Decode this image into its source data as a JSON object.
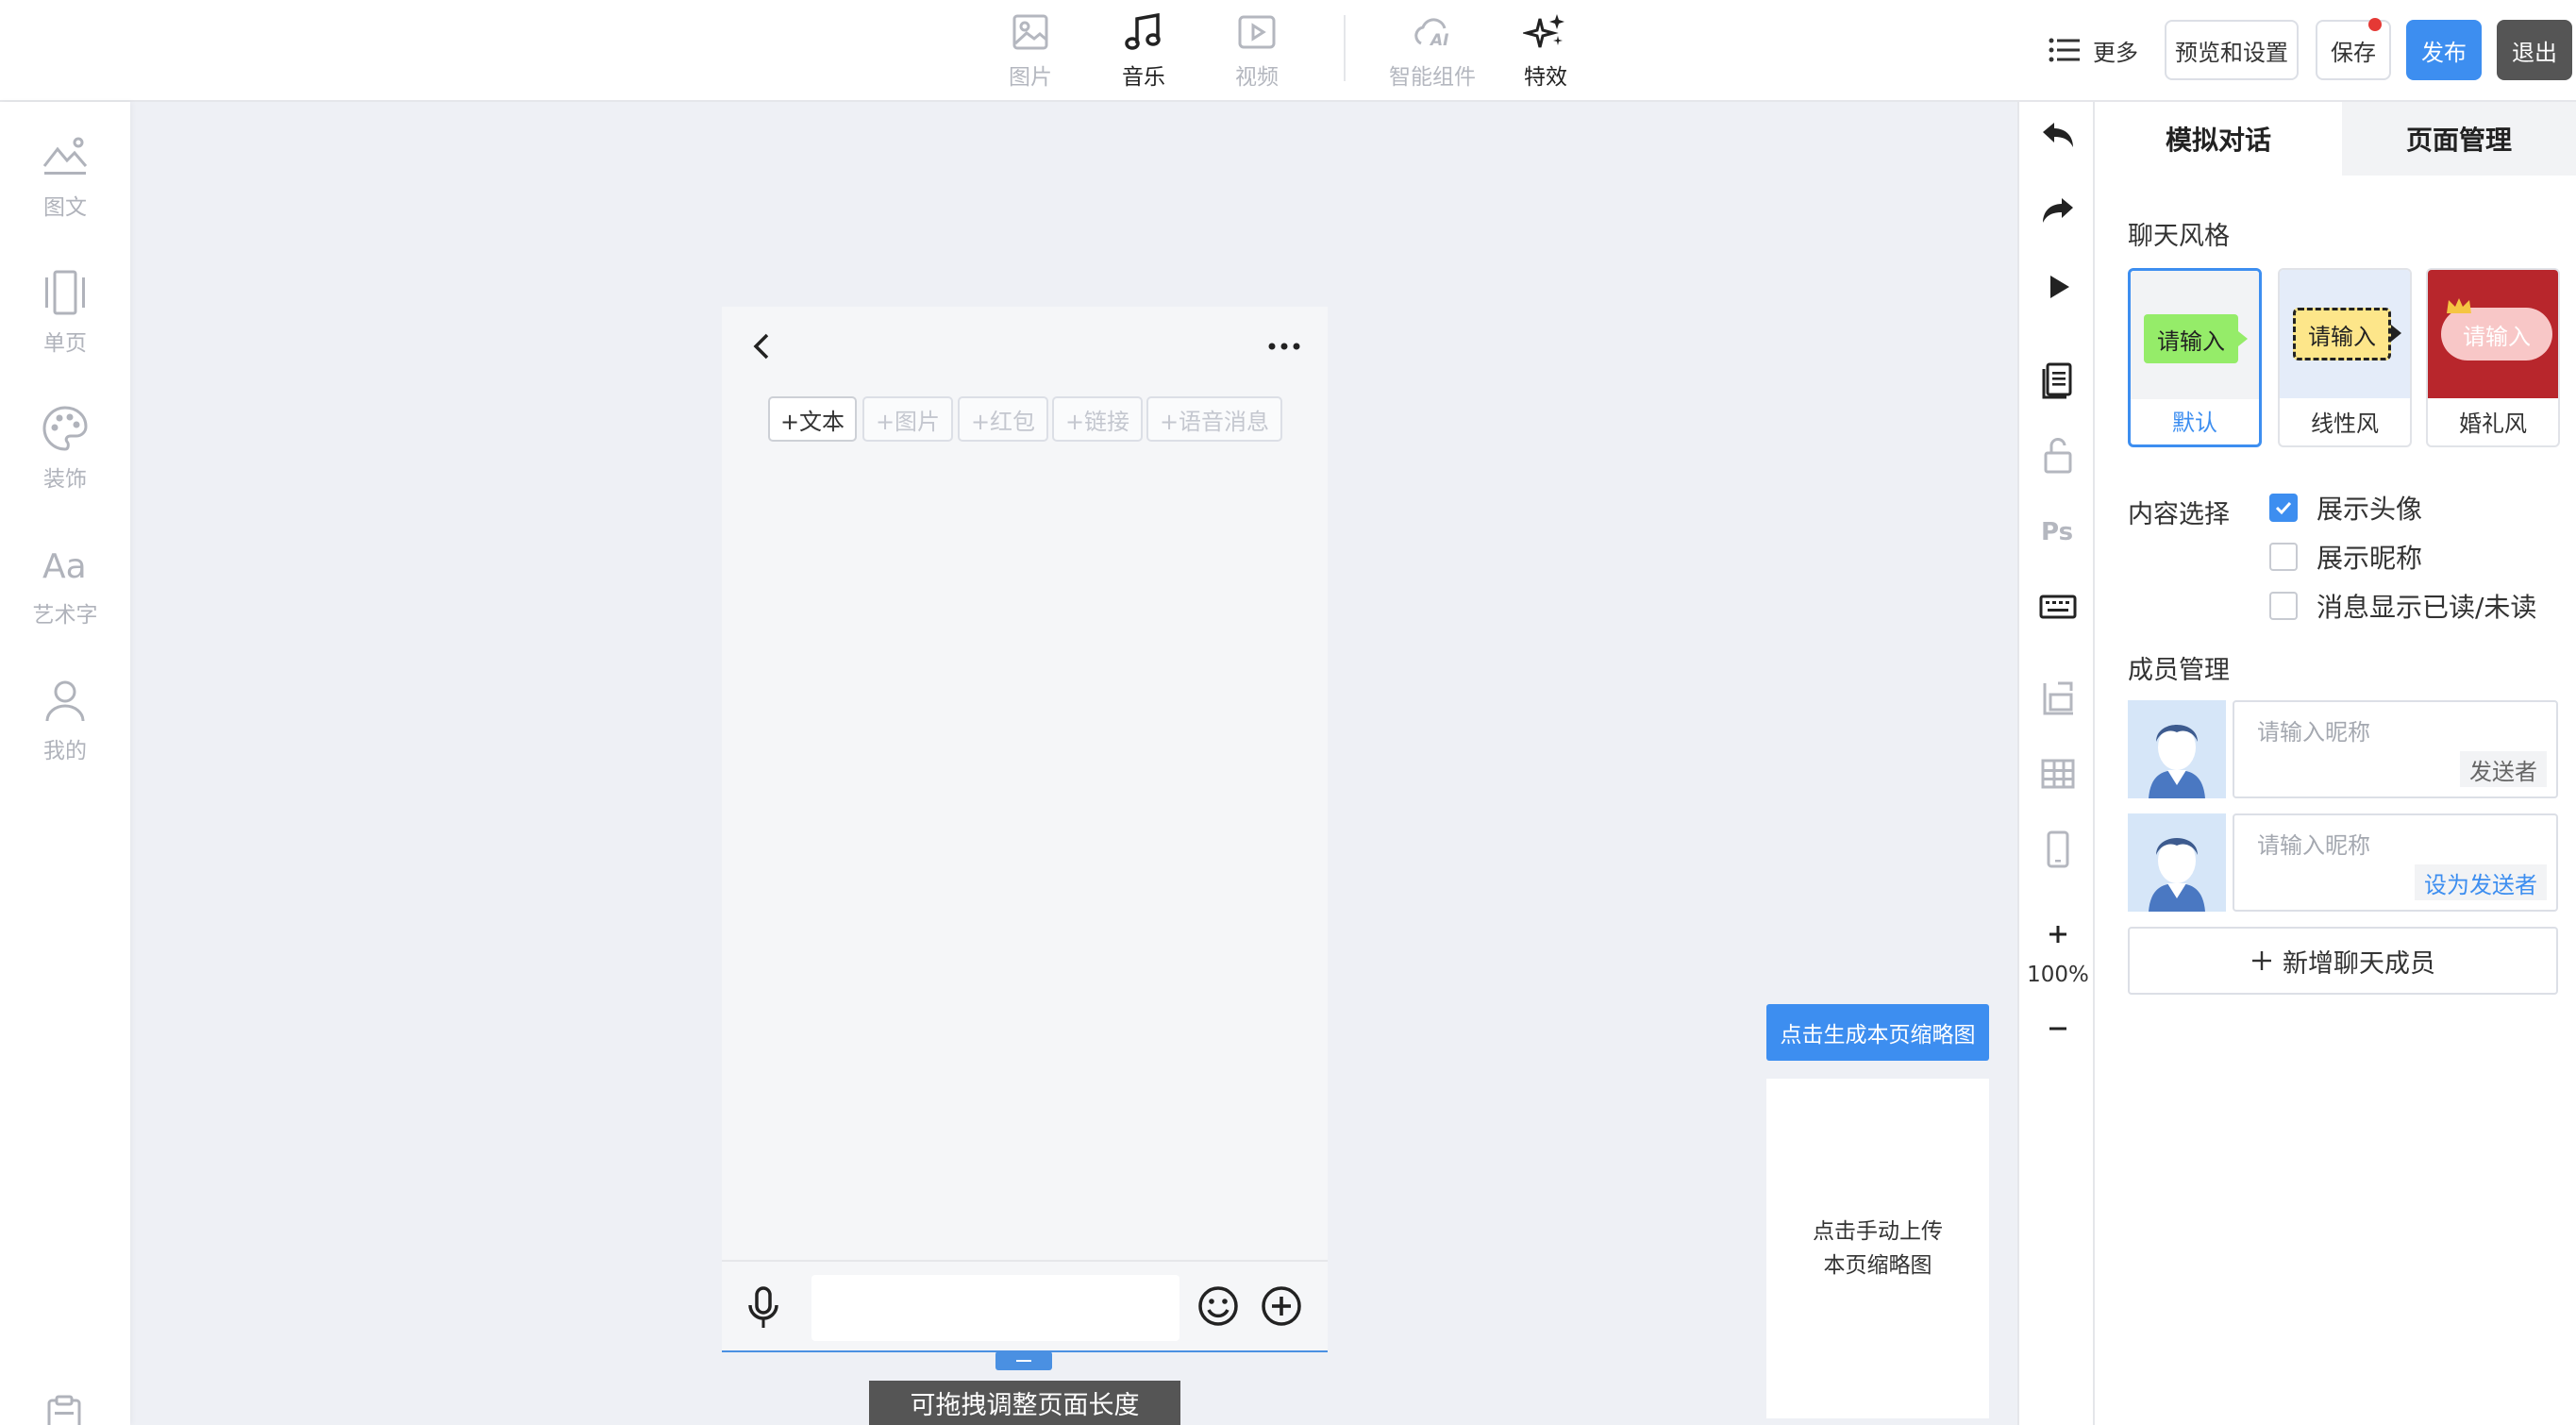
{
  "toolbar": {
    "tools": [
      {
        "label": "图片",
        "icon": "image-icon"
      },
      {
        "label": "音乐",
        "icon": "music-icon"
      },
      {
        "label": "视频",
        "icon": "video-icon"
      },
      {
        "label": "智能组件",
        "icon": "ai-icon"
      },
      {
        "label": "特效",
        "icon": "sparkle-icon"
      }
    ],
    "more_label": "更多",
    "preview_label": "预览和设置",
    "save_label": "保存",
    "publish_label": "发布",
    "exit_label": "退出",
    "colors": {
      "accent": "#3d8ef0",
      "exit": "#555555",
      "notify_dot": "#e53935"
    }
  },
  "sidebar": {
    "items": [
      {
        "label": "图文",
        "icon": "picture-text-icon"
      },
      {
        "label": "单页",
        "icon": "single-page-icon"
      },
      {
        "label": "装饰",
        "icon": "palette-icon"
      },
      {
        "label": "艺术字",
        "icon": "art-text-icon"
      },
      {
        "label": "我的",
        "icon": "user-icon"
      }
    ]
  },
  "phone": {
    "chips": [
      "+文本",
      "+图片",
      "+红包",
      "+链接",
      "+语音消息"
    ],
    "drag_hint": "可拖拽调整页面长度"
  },
  "thumbnail": {
    "generate_label": "点击生成本页缩略图",
    "upload_label_1": "点击手动上传",
    "upload_label_2": "本页缩略图"
  },
  "vstrip": {
    "zoom": "100%",
    "icons": [
      "undo-icon",
      "redo-icon",
      "play-icon",
      "layers-icon",
      "unlock-icon",
      "ps-icon",
      "keyboard-icon",
      "crop-icon",
      "grid-icon",
      "tablet-icon",
      "zoom-in-icon",
      "zoom-out-icon"
    ]
  },
  "panel": {
    "tabs": [
      "模拟对话",
      "页面管理"
    ],
    "chat_style_title": "聊天风格",
    "styles": [
      {
        "name": "默认",
        "preview_text": "请输入"
      },
      {
        "name": "线性风",
        "preview_text": "请输入"
      },
      {
        "name": "婚礼风",
        "preview_text": "请输入"
      }
    ],
    "content_title": "内容选择",
    "options": [
      {
        "label": "展示头像",
        "checked": true
      },
      {
        "label": "展示昵称",
        "checked": false
      },
      {
        "label": "消息显示已读/未读",
        "checked": false
      }
    ],
    "member_title": "成员管理",
    "members": [
      {
        "placeholder": "请输入昵称",
        "role": "发送者"
      },
      {
        "placeholder": "请输入昵称",
        "role": "设为发送者"
      }
    ],
    "add_member": "新增聊天成员"
  }
}
